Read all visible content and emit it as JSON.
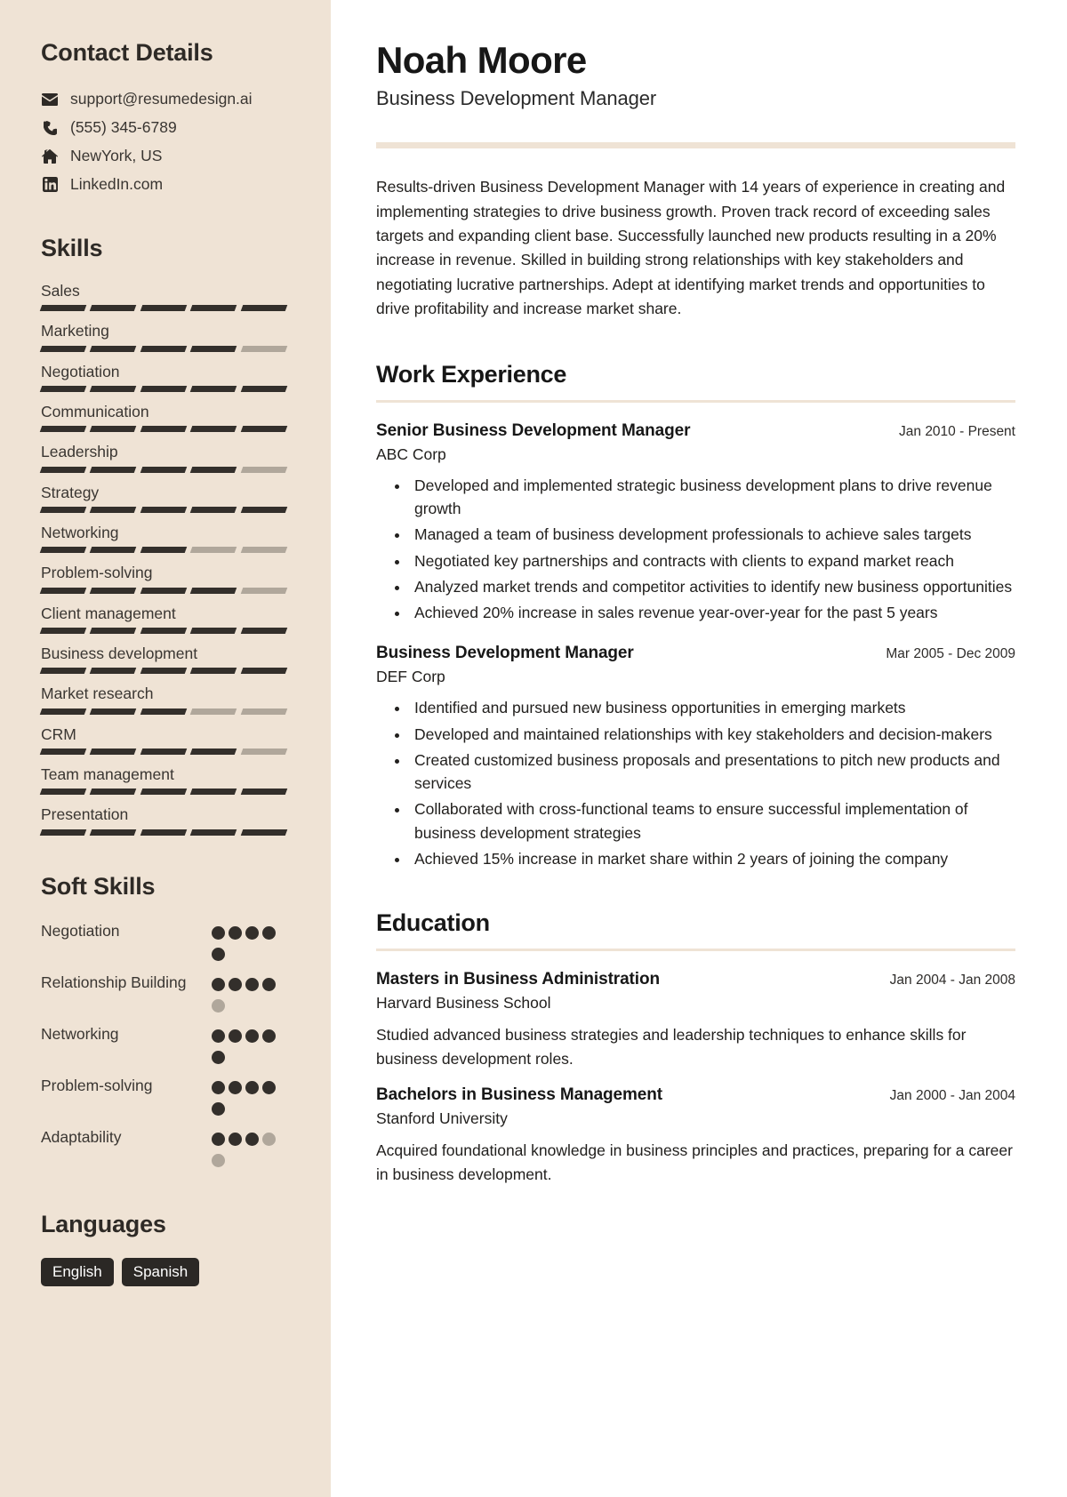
{
  "sidebar": {
    "contact": {
      "heading": "Contact Details",
      "items": [
        {
          "icon": "email-icon",
          "value": "support@resumedesign.ai"
        },
        {
          "icon": "phone-icon",
          "value": "(555) 345-6789"
        },
        {
          "icon": "home-icon",
          "value": "NewYork, US"
        },
        {
          "icon": "linkedin-icon",
          "value": "LinkedIn.com"
        }
      ]
    },
    "skills": {
      "heading": "Skills",
      "max": 5,
      "items": [
        {
          "label": "Sales",
          "level": 5
        },
        {
          "label": "Marketing",
          "level": 4
        },
        {
          "label": "Negotiation",
          "level": 5
        },
        {
          "label": "Communication",
          "level": 5
        },
        {
          "label": "Leadership",
          "level": 4
        },
        {
          "label": "Strategy",
          "level": 5
        },
        {
          "label": "Networking",
          "level": 3
        },
        {
          "label": "Problem-solving",
          "level": 4
        },
        {
          "label": "Client management",
          "level": 5
        },
        {
          "label": "Business development",
          "level": 5
        },
        {
          "label": "Market research",
          "level": 3
        },
        {
          "label": "CRM",
          "level": 4
        },
        {
          "label": "Team management",
          "level": 5
        },
        {
          "label": "Presentation",
          "level": 5
        }
      ]
    },
    "soft_skills": {
      "heading": "Soft Skills",
      "max": 5,
      "items": [
        {
          "label": "Negotiation",
          "level": 5
        },
        {
          "label": "Relationship Building",
          "level": 4
        },
        {
          "label": "Networking",
          "level": 5
        },
        {
          "label": "Problem-solving",
          "level": 5
        },
        {
          "label": "Adaptability",
          "level": 3
        }
      ]
    },
    "languages": {
      "heading": "Languages",
      "items": [
        "English",
        "Spanish"
      ]
    }
  },
  "main": {
    "name": "Noah Moore",
    "role": "Business Development Manager",
    "summary": "Results-driven Business Development Manager with 14 years of experience in creating and implementing strategies to drive business growth. Proven track record of exceeding sales targets and expanding client base. Successfully launched new products resulting in a 20% increase in revenue. Skilled in building strong relationships with key stakeholders and negotiating lucrative partnerships. Adept at identifying market trends and opportunities to drive profitability and increase market share.",
    "work": {
      "heading": "Work Experience",
      "entries": [
        {
          "title": "Senior Business Development Manager",
          "date": "Jan 2010 - Present",
          "org": "ABC Corp",
          "bullets": [
            "Developed and implemented strategic business development plans to drive revenue growth",
            "Managed a team of business development professionals to achieve sales targets",
            "Negotiated key partnerships and contracts with clients to expand market reach",
            "Analyzed market trends and competitor activities to identify new business opportunities",
            "Achieved 20% increase in sales revenue year-over-year for the past 5 years"
          ]
        },
        {
          "title": "Business Development Manager",
          "date": "Mar 2005 - Dec 2009",
          "org": "DEF Corp",
          "bullets": [
            "Identified and pursued new business opportunities in emerging markets",
            "Developed and maintained relationships with key stakeholders and decision-makers",
            "Created customized business proposals and presentations to pitch new products and services",
            "Collaborated with cross-functional teams to ensure successful implementation of business development strategies",
            "Achieved 15% increase in market share within 2 years of joining the company"
          ]
        }
      ]
    },
    "education": {
      "heading": "Education",
      "entries": [
        {
          "title": "Masters in Business Administration",
          "date": "Jan 2004 - Jan 2008",
          "org": "Harvard Business School",
          "desc": "Studied advanced business strategies and leadership techniques to enhance skills for business development roles."
        },
        {
          "title": "Bachelors in Business Management",
          "date": "Jan 2000 - Jan 2004",
          "org": "Stanford University",
          "desc": "Acquired foundational knowledge in business principles and practices, preparing for a career in business development."
        }
      ]
    }
  },
  "theme": {
    "sidebar_bg": "#EFE3D5",
    "accent_rule": "#EFE3D5",
    "dark": "#332F2B",
    "muted": "#B0A79B"
  }
}
